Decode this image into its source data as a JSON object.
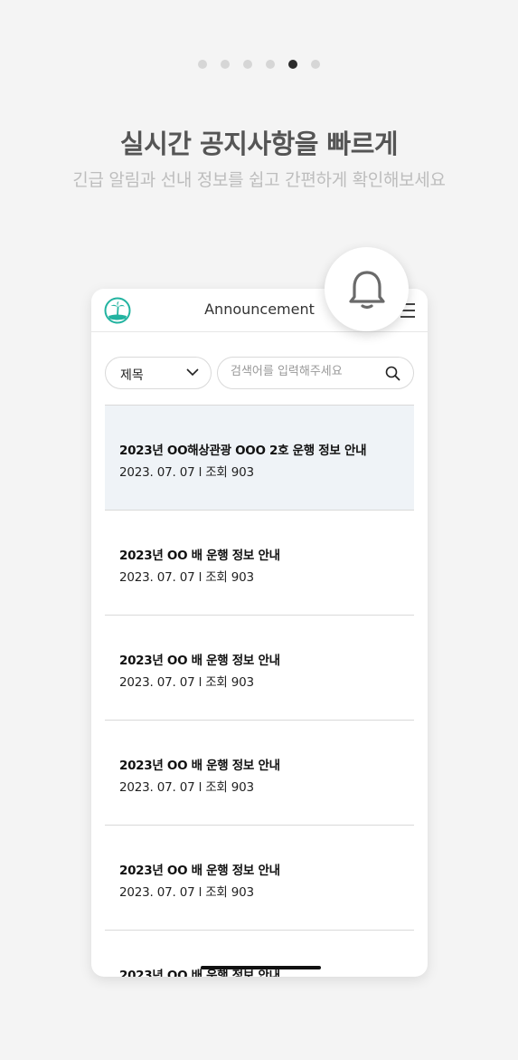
{
  "pager": {
    "count": 6,
    "active_index": 4
  },
  "hero": {
    "title": "실시간 공지사항을 빠르게",
    "subtitle": "긴급 알림과 선내 정보를 쉽고 간편하게 확인해보세요"
  },
  "app": {
    "header_title": "Announcement",
    "filter_select": {
      "selected": "제목"
    },
    "search": {
      "placeholder": "검색어를 입력해주세요",
      "value": ""
    },
    "items": [
      {
        "title": "2023년 OO해상관광 OOO 2호 운행 정보 안내",
        "meta": "2023. 07. 07 l 조회 903"
      },
      {
        "title": "2023년 OO 배 운행 정보 안내",
        "meta": "2023. 07. 07 l 조회 903"
      },
      {
        "title": "2023년 OO 배 운행 정보 안내",
        "meta": "2023. 07. 07 l 조회 903"
      },
      {
        "title": "2023년 OO 배 운행 정보 안내",
        "meta": "2023. 07. 07 l 조회 903"
      },
      {
        "title": "2023년 OO 배 운행 정보 안내",
        "meta": "2023. 07. 07 l 조회 903"
      },
      {
        "title": "2023년 OO 배 운행 정보 안내",
        "meta": ""
      }
    ]
  },
  "icons": {
    "logo": "palm-island-logo",
    "notify": "bell-icon",
    "menu": "hamburger-menu-icon",
    "search": "search-icon",
    "dropdown": "chevron-down-icon"
  },
  "colors": {
    "background": "#f4f4f4",
    "highlight_row": "#eff3f7",
    "logo_teal": "#22b3a0",
    "active_dot": "#2b2b2b"
  }
}
